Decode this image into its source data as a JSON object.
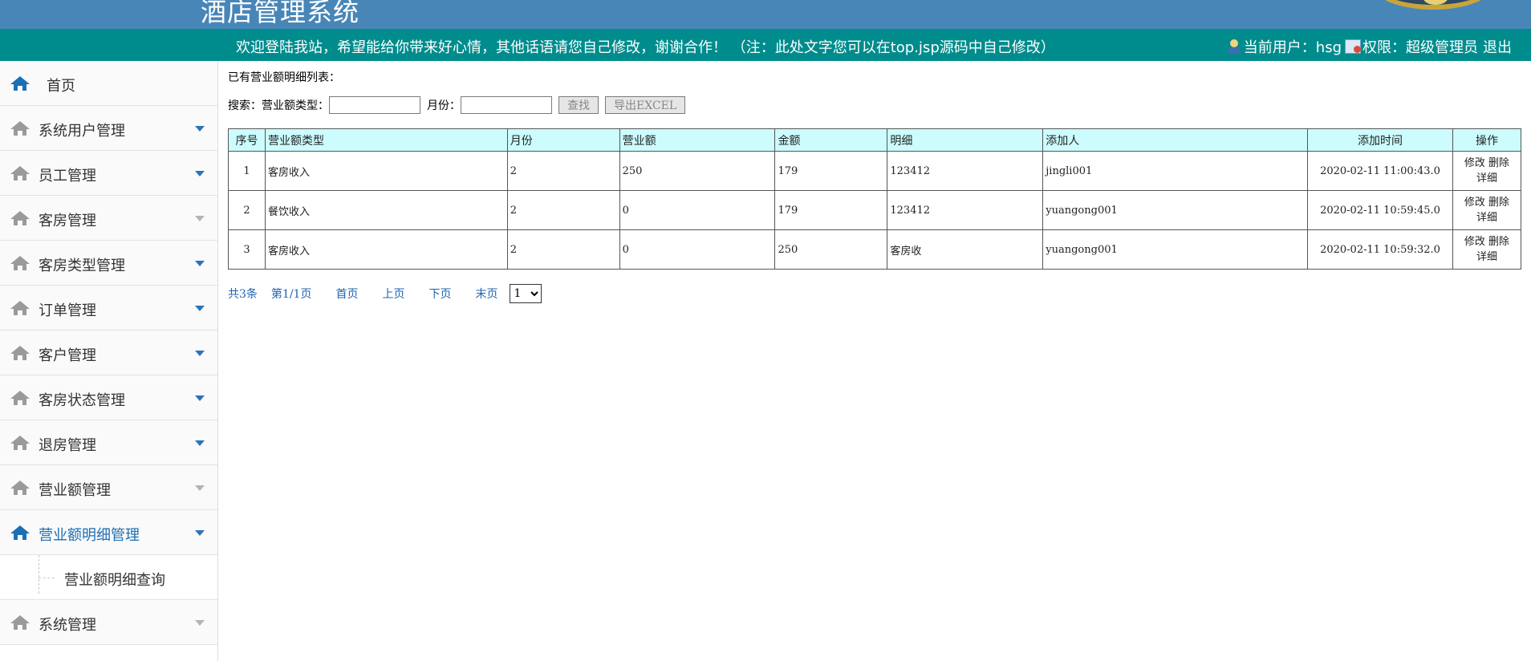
{
  "header": {
    "app_title": "酒店管理系统",
    "welcome_text": "欢迎登陆我站，希望能给你带来好心情，其他话语请您自己修改，谢谢合作！ （注：此处文字您可以在top.jsp源码中自己修改）",
    "current_user_label": "当前用户：hsg",
    "permission_label": "权限：超级管理员",
    "logout_label": "退出",
    "colors": {
      "top": "#4886b8",
      "bar": "#008c8d"
    }
  },
  "sidebar": {
    "items": [
      {
        "label": "首页",
        "icon": "home-icon",
        "has_caret": false,
        "active": false
      },
      {
        "label": "系统用户管理",
        "icon": "home-icon",
        "has_caret": true,
        "active": false
      },
      {
        "label": "员工管理",
        "icon": "home-icon",
        "has_caret": true,
        "active": false
      },
      {
        "label": "客房管理",
        "icon": "home-icon",
        "has_caret": true,
        "active": false
      },
      {
        "label": "客房类型管理",
        "icon": "home-icon",
        "has_caret": true,
        "active": false
      },
      {
        "label": "订单管理",
        "icon": "home-icon",
        "has_caret": true,
        "active": false
      },
      {
        "label": "客户管理",
        "icon": "home-icon",
        "has_caret": true,
        "active": false
      },
      {
        "label": "客房状态管理",
        "icon": "home-icon",
        "has_caret": true,
        "active": false
      },
      {
        "label": "退房管理",
        "icon": "home-icon",
        "has_caret": true,
        "active": false
      },
      {
        "label": "营业额管理",
        "icon": "home-icon",
        "has_caret": true,
        "active": false
      },
      {
        "label": "营业额明细管理",
        "icon": "home-icon",
        "has_caret": true,
        "active": true
      },
      {
        "label": "系统管理",
        "icon": "home-icon",
        "has_caret": true,
        "active": false
      }
    ],
    "sub_item": "营业额明细查询",
    "accent_color": "#1d6fb3"
  },
  "main": {
    "list_title": "已有营业额明细列表：",
    "search": {
      "prefix": "搜索：营业额类型：",
      "type_value": "",
      "month_label": "月份：",
      "month_value": "",
      "search_button": "查找",
      "export_button": "导出EXCEL"
    },
    "table": {
      "headers": [
        "序号",
        "营业额类型",
        "月份",
        "营业额",
        "金额",
        "明细",
        "添加人",
        "添加时间",
        "操作"
      ],
      "rows": [
        [
          "1",
          "客房收入",
          "2",
          "250",
          "179",
          "123412",
          "jingli001",
          "2020-02-11 11:00:43.0"
        ],
        [
          "2",
          "餐饮收入",
          "2",
          "0",
          "179",
          "123412",
          "yuangong001",
          "2020-02-11 10:59:45.0"
        ],
        [
          "3",
          "客房收入",
          "2",
          "0",
          "250",
          "客房收",
          "yuangong001",
          "2020-02-11 10:59:32.0"
        ]
      ],
      "actions": {
        "edit": "修改",
        "delete": "删除",
        "detail": "详细"
      },
      "header_bg": "#ccfcfd"
    },
    "pager": {
      "total": "共3条",
      "page": "第1/1页",
      "first": "首页",
      "prev": "上页",
      "next": "下页",
      "last": "末页",
      "selected_page": "1"
    }
  }
}
